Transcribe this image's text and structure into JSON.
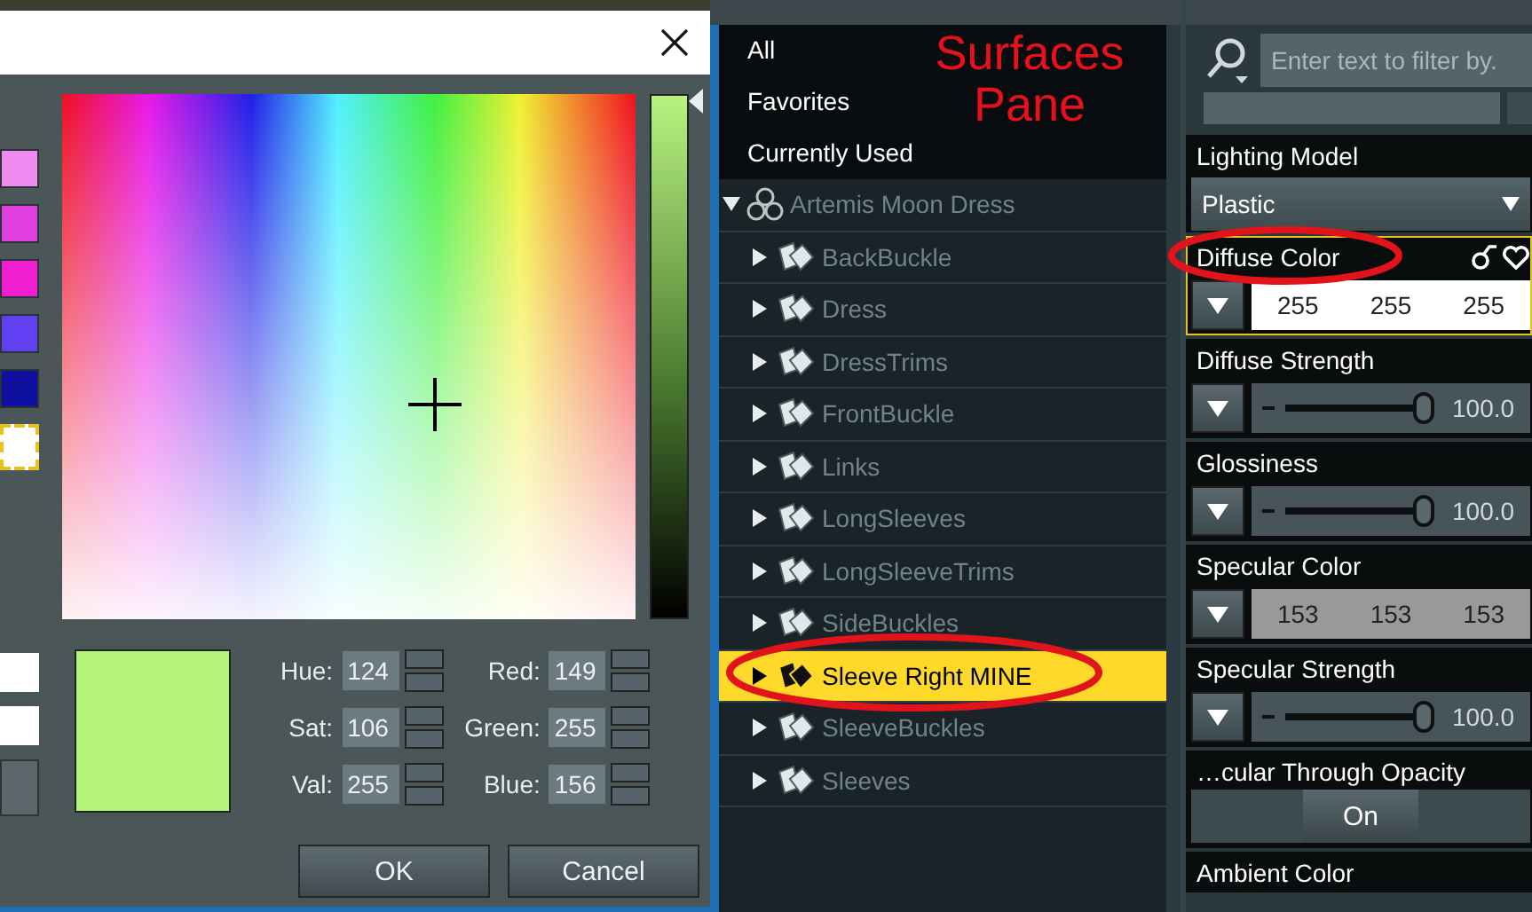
{
  "color_dialog": {
    "swatches": [
      {
        "color": "#f08cf0",
        "selected": false
      },
      {
        "color": "#e040e0",
        "selected": false
      },
      {
        "color": "#f020d0",
        "selected": false
      },
      {
        "color": "#6040f0",
        "selected": false
      },
      {
        "color": "#1010a0",
        "selected": false
      },
      {
        "color": "#ffffff",
        "selected": true
      }
    ],
    "hsv_fields": [
      {
        "label": "Hue:",
        "value": "124"
      },
      {
        "label": "Sat:",
        "value": "106"
      },
      {
        "label": "Val:",
        "value": "255"
      }
    ],
    "rgb_fields": [
      {
        "label": "Red:",
        "value": "149"
      },
      {
        "label": "Green:",
        "value": "255"
      },
      {
        "label": "Blue:",
        "value": "156"
      }
    ],
    "buttons": [
      "OK",
      "Cancel"
    ]
  },
  "surfaces_pane": {
    "annotation": "Surfaces Pane",
    "filters": [
      {
        "label": "All"
      },
      {
        "label": "Favorites"
      },
      {
        "label": "Currently Used"
      }
    ],
    "tree": [
      {
        "label": "Artemis Moon Dress",
        "expanded": true,
        "selected": false,
        "children": [
          {
            "label": "BackBuckle",
            "expanded": false,
            "selected": false
          },
          {
            "label": "Dress",
            "expanded": false,
            "selected": false
          },
          {
            "label": "DressTrims",
            "expanded": false,
            "selected": false
          },
          {
            "label": "FrontBuckle",
            "expanded": false,
            "selected": false
          },
          {
            "label": "Links",
            "expanded": false,
            "selected": false
          },
          {
            "label": "LongSleeves",
            "expanded": false,
            "selected": false
          },
          {
            "label": "LongSleeveTrims",
            "expanded": false,
            "selected": false
          },
          {
            "label": "SideBuckles",
            "expanded": false,
            "selected": false
          },
          {
            "label": "Sleeve Right MINE",
            "expanded": false,
            "selected": true
          },
          {
            "label": "SleeveBuckles",
            "expanded": false,
            "selected": false
          },
          {
            "label": "Sleeves",
            "expanded": false,
            "selected": false
          }
        ]
      }
    ]
  },
  "properties_pane": {
    "search": {
      "placeholder": "Enter text to filter by."
    },
    "properties": [
      {
        "kind": "dropdown",
        "label": "Lighting Model",
        "value": "Plastic",
        "selected": false
      },
      {
        "kind": "color",
        "label": "Diffuse Color",
        "values": [
          "255",
          "255",
          "255"
        ],
        "selected": true
      },
      {
        "kind": "slider",
        "label": "Diffuse Strength",
        "level": 1,
        "reading": "100.0",
        "selected": false
      },
      {
        "kind": "slider",
        "label": "Glossiness",
        "level": 1,
        "reading": "100.0",
        "selected": false
      },
      {
        "kind": "color",
        "label": "Specular Color",
        "values": [
          "153",
          "153",
          "153"
        ],
        "selected": false
      },
      {
        "kind": "slider",
        "label": "Specular Strength",
        "level": 1,
        "reading": "100.0",
        "selected": false
      },
      {
        "kind": "toggle",
        "label": "…cular Through Opacity",
        "value": "On",
        "selected": false
      },
      {
        "kind": "color",
        "label": "Ambient Color",
        "selected": false
      }
    ]
  }
}
